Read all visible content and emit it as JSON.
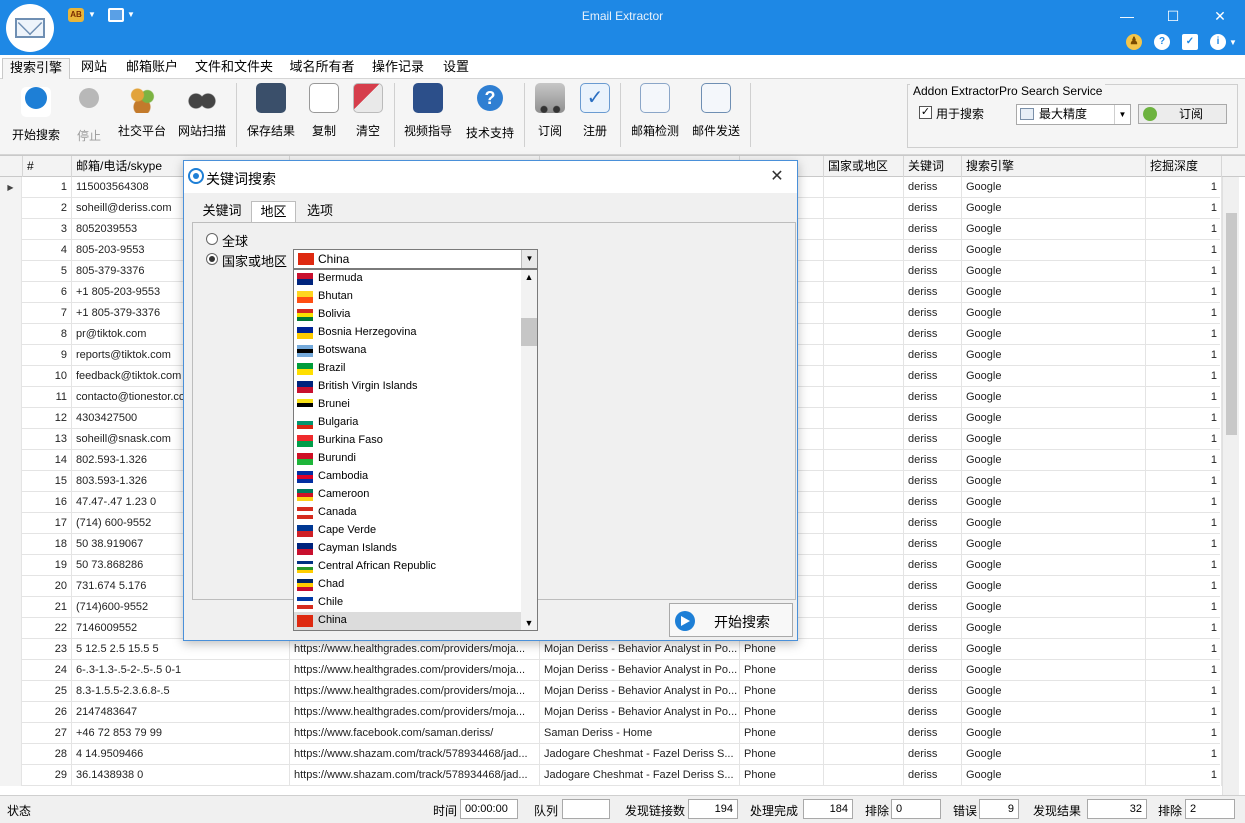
{
  "app": {
    "title": "Email Extractor",
    "accent": "#1e88e5"
  },
  "menu": {
    "tabs": [
      "搜索引擎",
      "网站",
      "邮箱账户",
      "文件和文件夹",
      "域名所有者",
      "操作记录",
      "设置"
    ]
  },
  "toolbar": {
    "buttons": [
      {
        "label": "开始搜索",
        "icon": "play-icon"
      },
      {
        "label": "停止",
        "icon": "stop-icon"
      },
      {
        "label": "社交平台",
        "icon": "people-icon"
      },
      {
        "label": "网站扫描",
        "icon": "binoculars-icon"
      },
      {
        "label": "保存结果",
        "icon": "save-icon"
      },
      {
        "label": "复制",
        "icon": "copy-icon"
      },
      {
        "label": "清空",
        "icon": "eraser-icon"
      },
      {
        "label": "视频指导",
        "icon": "video-icon"
      },
      {
        "label": "技术支持",
        "icon": "help-icon"
      },
      {
        "label": "订阅",
        "icon": "cart-icon"
      },
      {
        "label": "注册",
        "icon": "check-icon"
      },
      {
        "label": "邮箱检测",
        "icon": "mail-check-icon"
      },
      {
        "label": "邮件发送",
        "icon": "mail-icon"
      }
    ]
  },
  "addon": {
    "title": "Addon ExtractorPro Search Service",
    "use_label": "用于搜索",
    "use_checked": true,
    "precision_value": "最大精度",
    "subscribe_label": "订阅"
  },
  "grid": {
    "headers": [
      "#",
      "邮箱/电话/skype",
      "",
      "",
      "",
      "国家或地区",
      "关键词",
      "搜索引擎",
      "挖掘深度"
    ],
    "rows": [
      {
        "n": "1",
        "v": "115003564308",
        "url": "",
        "title": "",
        "type": "",
        "kw": "deriss",
        "eng": "Google",
        "d": "1"
      },
      {
        "n": "2",
        "v": "soheill@deriss.com",
        "url": "",
        "title": "",
        "type": "",
        "kw": "deriss",
        "eng": "Google",
        "d": "1"
      },
      {
        "n": "3",
        "v": "8052039553",
        "url": "",
        "title": "",
        "type": "",
        "kw": "deriss",
        "eng": "Google",
        "d": "1"
      },
      {
        "n": "4",
        "v": "805-203-9553",
        "url": "",
        "title": "",
        "type": "",
        "kw": "deriss",
        "eng": "Google",
        "d": "1"
      },
      {
        "n": "5",
        "v": "805-379-3376",
        "url": "",
        "title": "",
        "type": "",
        "kw": "deriss",
        "eng": "Google",
        "d": "1"
      },
      {
        "n": "6",
        "v": "+1 805-203-9553",
        "url": "",
        "title": "",
        "type": "",
        "kw": "deriss",
        "eng": "Google",
        "d": "1"
      },
      {
        "n": "7",
        "v": "+1 805-379-3376",
        "url": "",
        "title": "",
        "type": "",
        "kw": "deriss",
        "eng": "Google",
        "d": "1"
      },
      {
        "n": "8",
        "v": "pr@tiktok.com",
        "url": "",
        "title": "",
        "type": "",
        "kw": "deriss",
        "eng": "Google",
        "d": "1"
      },
      {
        "n": "9",
        "v": "reports@tiktok.com",
        "url": "",
        "title": "",
        "type": "",
        "kw": "deriss",
        "eng": "Google",
        "d": "1"
      },
      {
        "n": "10",
        "v": "feedback@tiktok.com",
        "url": "",
        "title": "",
        "type": "",
        "kw": "deriss",
        "eng": "Google",
        "d": "1"
      },
      {
        "n": "11",
        "v": "contacto@tionestor.co",
        "url": "",
        "title": "",
        "type": "",
        "kw": "deriss",
        "eng": "Google",
        "d": "1"
      },
      {
        "n": "12",
        "v": "4303427500",
        "url": "",
        "title": "",
        "type": "",
        "kw": "deriss",
        "eng": "Google",
        "d": "1"
      },
      {
        "n": "13",
        "v": "soheill@snask.com",
        "url": "",
        "title": "",
        "type": "",
        "kw": "deriss",
        "eng": "Google",
        "d": "1"
      },
      {
        "n": "14",
        "v": "802.593-1.326",
        "url": "",
        "title": "",
        "type": "",
        "kw": "deriss",
        "eng": "Google",
        "d": "1"
      },
      {
        "n": "15",
        "v": "803.593-1.326",
        "url": "",
        "title": "",
        "type": "",
        "kw": "deriss",
        "eng": "Google",
        "d": "1"
      },
      {
        "n": "16",
        "v": "47.47-.47 1.23 0",
        "url": "",
        "title": "",
        "type": "",
        "kw": "deriss",
        "eng": "Google",
        "d": "1"
      },
      {
        "n": "17",
        "v": "(714) 600-9552",
        "url": "",
        "title": "",
        "type": "",
        "kw": "deriss",
        "eng": "Google",
        "d": "1"
      },
      {
        "n": "18",
        "v": "50 38.919067",
        "url": "",
        "title": "",
        "type": "",
        "kw": "deriss",
        "eng": "Google",
        "d": "1"
      },
      {
        "n": "19",
        "v": "50 73.868286",
        "url": "",
        "title": "",
        "type": "",
        "kw": "deriss",
        "eng": "Google",
        "d": "1"
      },
      {
        "n": "20",
        "v": "731.674 5.176",
        "url": "",
        "title": "",
        "type": "",
        "kw": "deriss",
        "eng": "Google",
        "d": "1"
      },
      {
        "n": "21",
        "v": "(714)600-9552",
        "url": "",
        "title": "",
        "type": "",
        "kw": "deriss",
        "eng": "Google",
        "d": "1"
      },
      {
        "n": "22",
        "v": "7146009552",
        "url": "",
        "title": "",
        "type": "",
        "kw": "deriss",
        "eng": "Google",
        "d": "1"
      },
      {
        "n": "23",
        "v": "5 12.5 2.5 15.5 5",
        "url": "https://www.healthgrades.com/providers/moja...",
        "title": "Mojan Deriss - Behavior Analyst in Po...",
        "type": "Phone",
        "kw": "deriss",
        "eng": "Google",
        "d": "1"
      },
      {
        "n": "24",
        "v": "6-.3-1.3-.5-2-.5-.5 0-1",
        "url": "https://www.healthgrades.com/providers/moja...",
        "title": "Mojan Deriss - Behavior Analyst in Po...",
        "type": "Phone",
        "kw": "deriss",
        "eng": "Google",
        "d": "1"
      },
      {
        "n": "25",
        "v": "8.3-1.5.5-2.3.6.8-.5",
        "url": "https://www.healthgrades.com/providers/moja...",
        "title": "Mojan Deriss - Behavior Analyst in Po...",
        "type": "Phone",
        "kw": "deriss",
        "eng": "Google",
        "d": "1"
      },
      {
        "n": "26",
        "v": "2147483647",
        "url": "https://www.healthgrades.com/providers/moja...",
        "title": "Mojan Deriss - Behavior Analyst in Po...",
        "type": "Phone",
        "kw": "deriss",
        "eng": "Google",
        "d": "1"
      },
      {
        "n": "27",
        "v": "+46 72 853 79 99",
        "url": "https://www.facebook.com/saman.deriss/",
        "title": "Saman Deriss - Home",
        "type": "Phone",
        "kw": "deriss",
        "eng": "Google",
        "d": "1"
      },
      {
        "n": "28",
        "v": "4 14.9509466",
        "url": "https://www.shazam.com/track/578934468/jad...",
        "title": "Jadogare Cheshmat - Fazel Deriss  S...",
        "type": "Phone",
        "kw": "deriss",
        "eng": "Google",
        "d": "1"
      },
      {
        "n": "29",
        "v": "36.1438938 0",
        "url": "https://www.shazam.com/track/578934468/jad...",
        "title": "Jadogare Cheshmat - Fazel Deriss  S...",
        "type": "Phone",
        "kw": "deriss",
        "eng": "Google",
        "d": "1"
      }
    ]
  },
  "status": {
    "state_label": "状态",
    "time_label": "时间",
    "time_value": "00:00:00",
    "queue_label": "队列",
    "queue_value": "",
    "links_label": "发现链接数",
    "links_value": "194",
    "done_label": "处理完成",
    "done_value": "184",
    "excluded_label": "排除",
    "excluded_value": "0",
    "errors_label": "错误",
    "errors_value": "9",
    "found_label": "发现结果",
    "found_value": "32",
    "excluded2_label": "排除",
    "excluded2_value": "2"
  },
  "dialog": {
    "title": "关键词搜索",
    "tabs": [
      "关键词",
      "地区",
      "选项"
    ],
    "active_tab": "地区",
    "radio_global": "全球",
    "radio_country": "国家或地区",
    "selected_country": "China",
    "countries": [
      {
        "name": "Bermuda",
        "flag": [
          "#c8102e",
          "#00247d"
        ]
      },
      {
        "name": "Bhutan",
        "flag": [
          "#ffd520",
          "#ff4e12"
        ]
      },
      {
        "name": "Bolivia",
        "flag": [
          "#d52b1e",
          "#f9e300",
          "#007934"
        ]
      },
      {
        "name": "Bosnia Herzegovina",
        "flag": [
          "#002395",
          "#fecb00"
        ]
      },
      {
        "name": "Botswana",
        "flag": [
          "#75aadb",
          "#000000",
          "#75aadb"
        ]
      },
      {
        "name": "Brazil",
        "flag": [
          "#009c3b",
          "#ffdf00"
        ]
      },
      {
        "name": "British Virgin Islands",
        "flag": [
          "#00247d",
          "#c8102e"
        ]
      },
      {
        "name": "Brunei",
        "flag": [
          "#f7e017",
          "#000000",
          "#ffffff"
        ]
      },
      {
        "name": "Bulgaria",
        "flag": [
          "#ffffff",
          "#00966e",
          "#d62612"
        ]
      },
      {
        "name": "Burkina Faso",
        "flag": [
          "#ef2b2d",
          "#009e49"
        ]
      },
      {
        "name": "Burundi",
        "flag": [
          "#ce1126",
          "#1eb53a"
        ]
      },
      {
        "name": "Cambodia",
        "flag": [
          "#032ea1",
          "#e00025",
          "#032ea1"
        ]
      },
      {
        "name": "Cameroon",
        "flag": [
          "#007a5e",
          "#ce1126",
          "#fcd116"
        ]
      },
      {
        "name": "Canada",
        "flag": [
          "#d52b1e",
          "#ffffff",
          "#d52b1e"
        ]
      },
      {
        "name": "Cape Verde",
        "flag": [
          "#003893",
          "#cf2027"
        ]
      },
      {
        "name": "Cayman Islands",
        "flag": [
          "#00247d",
          "#c8102e"
        ]
      },
      {
        "name": "Central African Republic",
        "flag": [
          "#003082",
          "#ffffff",
          "#289728",
          "#ffce00"
        ]
      },
      {
        "name": "Chad",
        "flag": [
          "#002664",
          "#fecb00",
          "#c60c30"
        ]
      },
      {
        "name": "Chile",
        "flag": [
          "#0039a6",
          "#ffffff",
          "#d52b1e"
        ]
      },
      {
        "name": "China",
        "flag": [
          "#de2910",
          "#de2910"
        ]
      }
    ],
    "start_label": "开始搜索"
  }
}
